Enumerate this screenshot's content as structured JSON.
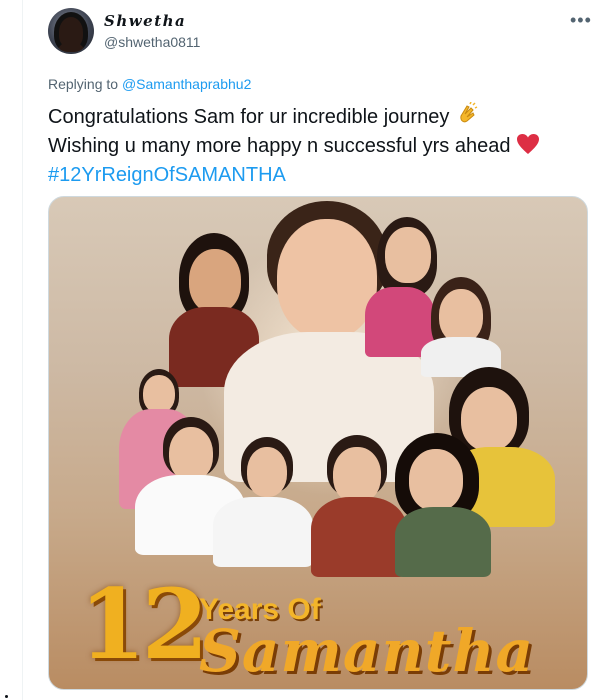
{
  "user": {
    "display_name": "Shwetha",
    "handle": "@shwetha0811"
  },
  "more_icon": "more-horizontal-icon",
  "reply": {
    "prefix": "Replying to",
    "target": "@Samanthaprabhu2"
  },
  "tweet": {
    "line1": "Congratulations Sam for ur incredible journey",
    "line2": "Wishing u many more happy n successful yrs ahead",
    "hashtag": "#12YrReignOfSAMANTHA",
    "emoji1": "clapping-hands-emoji",
    "emoji2": "red-heart-emoji"
  },
  "media": {
    "number": "12",
    "years_of": "Years Of",
    "name": "Samantha"
  },
  "colors": {
    "link": "#1d9bf0",
    "text": "#0f1419",
    "secondary": "#536471",
    "gold": "#f0b020"
  }
}
